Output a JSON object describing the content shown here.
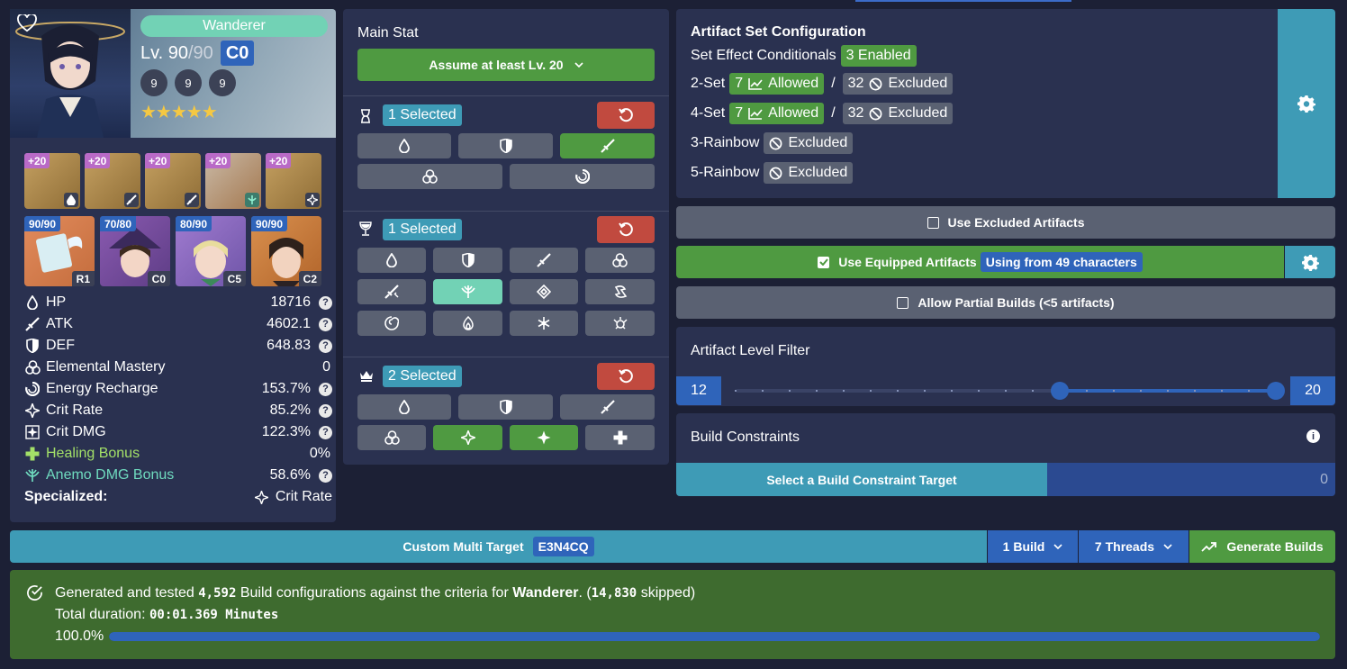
{
  "character": {
    "name": "Wanderer",
    "level": "Lv. 90",
    "level_max": "/90",
    "constellation": "C0",
    "talents": [
      "9",
      "9",
      "9"
    ],
    "stars": "★★★★★",
    "artifacts": [
      {
        "level": "+20",
        "sub": "hp-icon"
      },
      {
        "level": "+20",
        "sub": "atk-icon"
      },
      {
        "level": "+20",
        "sub": "atk-icon"
      },
      {
        "level": "+20",
        "sub": "anemo-icon"
      },
      {
        "level": "+20",
        "sub": "crit-icon"
      }
    ],
    "equip": [
      {
        "level": "90/90",
        "badge": "R1"
      },
      {
        "level": "70/80",
        "badge": "C0"
      },
      {
        "level": "80/90",
        "badge": "C5"
      },
      {
        "level": "90/90",
        "badge": "C2"
      }
    ],
    "stats": [
      {
        "label": "HP",
        "value": "18716"
      },
      {
        "label": "ATK",
        "value": "4602.1"
      },
      {
        "label": "DEF",
        "value": "648.83"
      },
      {
        "label": "Elemental Mastery",
        "value": "0"
      },
      {
        "label": "Energy Recharge",
        "value": "153.7%"
      },
      {
        "label": "Crit Rate",
        "value": "85.2%"
      },
      {
        "label": "Crit DMG",
        "value": "122.3%"
      },
      {
        "label": "Healing Bonus",
        "value": "0%"
      },
      {
        "label": "Anemo DMG Bonus",
        "value": "58.6%"
      }
    ],
    "specialized_label": "Specialized:",
    "specialized_value": "Crit Rate",
    "colors": {
      "healing": "#a3e068",
      "anemo": "#6fdbbf"
    }
  },
  "main_stat": {
    "title": "Main Stat",
    "assume_label": "Assume at least Lv. 20",
    "sands_selected": "1 Selected",
    "goblet_selected": "1 Selected",
    "circlet_selected": "2 Selected"
  },
  "set_config": {
    "title": "Artifact Set Configuration",
    "conditionals_label": "Set Effect Conditionals",
    "conditionals_value": "3 Enabled",
    "rows": [
      {
        "label": "2-Set",
        "allowed_count": "7",
        "allowed": "Allowed",
        "excluded_count": "32",
        "excluded": "Excluded"
      },
      {
        "label": "4-Set",
        "allowed_count": "7",
        "allowed": "Allowed",
        "excluded_count": "32",
        "excluded": "Excluded"
      }
    ],
    "slash": "/",
    "rainbow3": "3-Rainbow",
    "rainbow5": "5-Rainbow",
    "excluded": "Excluded"
  },
  "options": {
    "use_excluded": "Use Excluded Artifacts",
    "use_equipped": "Use Equipped Artifacts",
    "using_from": "Using from 49 characters",
    "allow_partial": "Allow Partial Builds (<5 artifacts)"
  },
  "level_filter": {
    "title": "Artifact Level Filter",
    "min": "12",
    "max": "20",
    "low": 12,
    "high": 20,
    "range": [
      0,
      20
    ]
  },
  "constraints": {
    "title": "Build Constraints",
    "target_label": "Select a Build Constraint Target",
    "value": "0"
  },
  "bottom": {
    "target_label": "Custom Multi Target",
    "target_code": "E3N4CQ",
    "builds": "1 Build",
    "threads": "7 Threads",
    "generate": "Generate Builds"
  },
  "result": {
    "prefix": "Generated and tested",
    "count": "4,592",
    "middle": "Build configurations against the criteria for",
    "character": "Wanderer",
    "dot_open": ". (",
    "skipped_count": "14,830",
    "skipped_suffix": "skipped)",
    "duration_label": "Total duration:",
    "duration": "00:01.369 Minutes",
    "progress_label": "100.0%",
    "progress": 1.0
  }
}
